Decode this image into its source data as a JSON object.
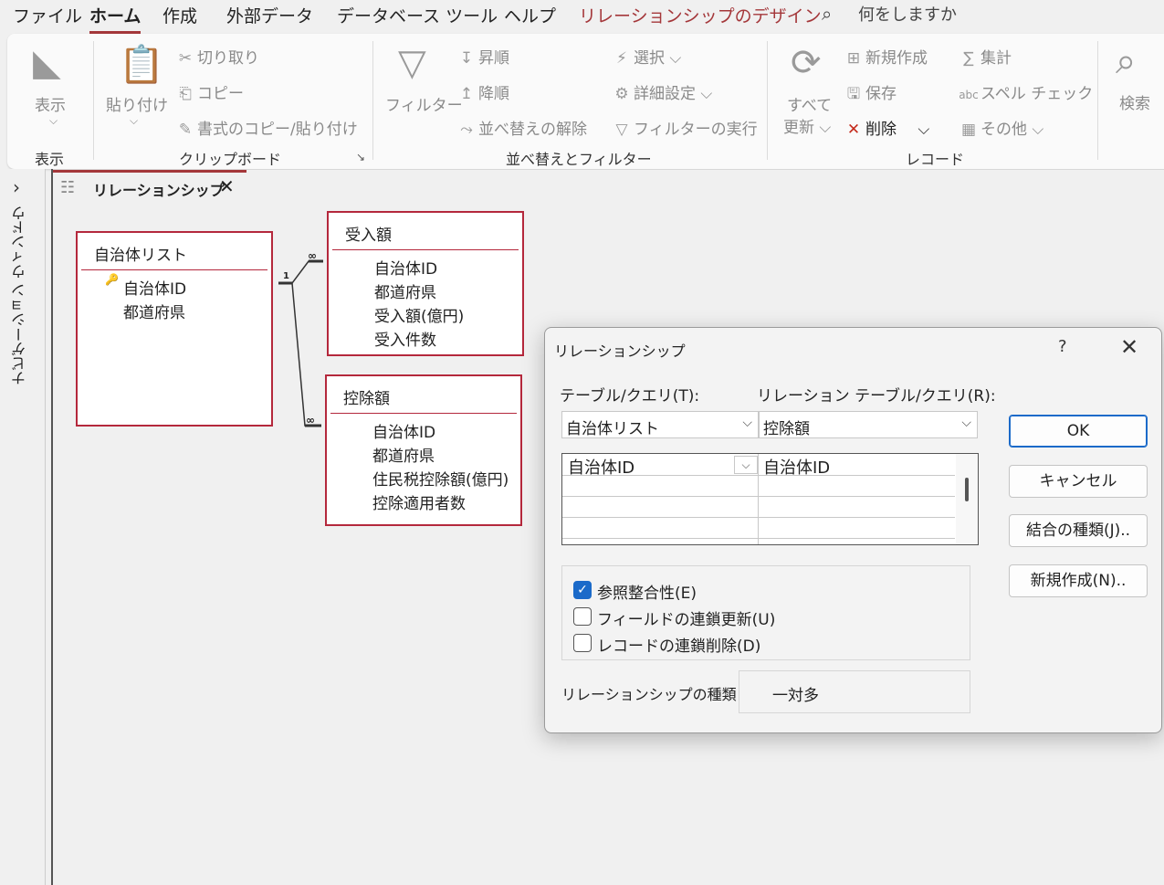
{
  "menu": {
    "items": [
      "ファイル",
      "ホーム",
      "作成",
      "外部データ",
      "データベース ツール",
      "ヘルプ",
      "リレーションシップのデザイン"
    ],
    "search_placeholder": "何をしますか",
    "accent_color": "#a4373a"
  },
  "ribbon": {
    "view": {
      "label": "表示",
      "group": "表示"
    },
    "clipboard": {
      "paste": "貼り付け",
      "cut": "切り取り",
      "copy": "コピー",
      "format_painter": "書式のコピー/貼り付け",
      "group": "クリップボード"
    },
    "sort_filter": {
      "filter": "フィルター",
      "ascending": "昇順",
      "descending": "降順",
      "clear_sort": "並べ替えの解除",
      "selection": "選択",
      "advanced": "詳細設定",
      "toggle_filter": "フィルターの実行",
      "group": "並べ替えとフィルター"
    },
    "records": {
      "refresh_all_line1": "すべて",
      "refresh_all_line2": "更新",
      "new": "新規作成",
      "save": "保存",
      "delete": "削除",
      "totals": "集計",
      "spelling": "スペル チェック",
      "more": "その他",
      "group": "レコード"
    },
    "find": {
      "label": "検索"
    }
  },
  "nav_pane": {
    "label": "ナビゲーション ウィンドウ"
  },
  "doc_tab": {
    "label": "リレーションシップ"
  },
  "tables": [
    {
      "title": "自治体リスト",
      "fields": [
        "自治体ID",
        "都道府県"
      ]
    },
    {
      "title": "受入額",
      "fields": [
        "自治体ID",
        "都道府県",
        "受入額(億円)",
        "受入件数"
      ]
    },
    {
      "title": "控除額",
      "fields": [
        "自治体ID",
        "都道府県",
        "住民税控除額(億円)",
        "控除適用者数"
      ]
    }
  ],
  "relations": {
    "one": "1",
    "many": "∞"
  },
  "dialog": {
    "title": "リレーションシップ",
    "help": "?",
    "table_label": "テーブル/クエリ(T):",
    "related_table_label": "リレーション テーブル/クエリ(R):",
    "table_value": "自治体リスト",
    "related_table_value": "控除額",
    "field_left": "自治体ID",
    "field_right": "自治体ID",
    "enforce_integrity": {
      "label": "参照整合性(E)",
      "checked": true
    },
    "cascade_update": {
      "label": "フィールドの連鎖更新(U)",
      "checked": false
    },
    "cascade_delete": {
      "label": "レコードの連鎖削除(D)",
      "checked": false
    },
    "relationship_type_label": "リレーションシップの種類：",
    "relationship_type_value": "一対多",
    "buttons": {
      "ok": "OK",
      "cancel": "キャンセル",
      "join_type": "結合の種類(J)..",
      "create_new": "新規作成(N).."
    }
  }
}
